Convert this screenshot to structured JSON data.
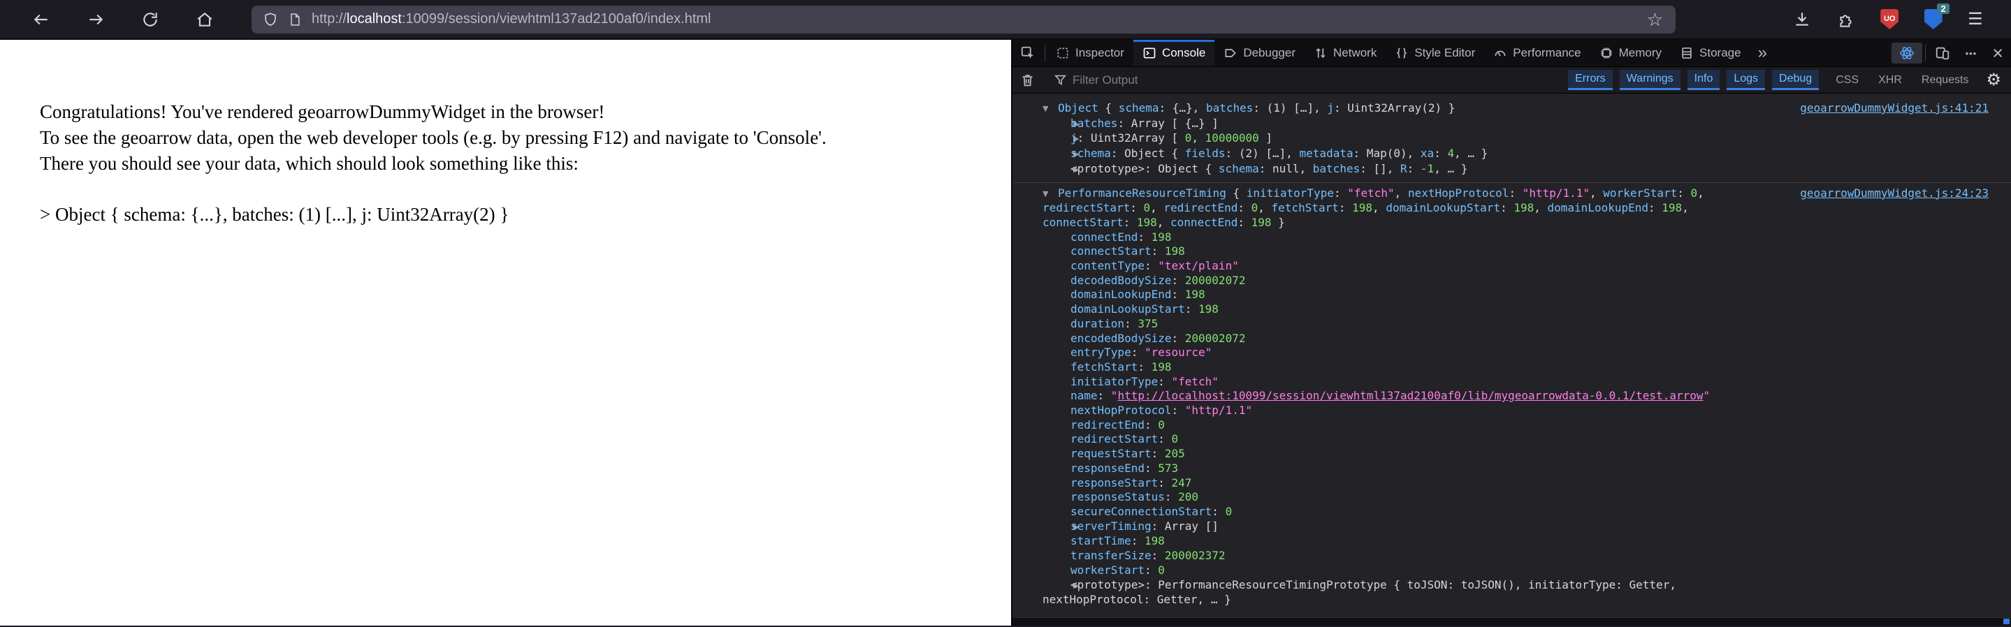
{
  "colors": {
    "accent_blue": "#2b6fd9",
    "property_name_blue": "#75bfff",
    "number_green": "#86de74",
    "string_pink": "#ff7de9",
    "console_bg": "#232327",
    "toolbar_bg": "#1c1b22",
    "urlbar_bg": "#42414d",
    "page_bg": "#ffffff"
  },
  "browser": {
    "url": {
      "prefix": "http://",
      "host": "localhost",
      "rest": ":10099/session/viewhtml137ad2100af0/index.html"
    },
    "extension_badge": "2",
    "icons": {
      "star": "☆",
      "menu": "☰",
      "ublock_label": "UO"
    }
  },
  "page": {
    "lines": [
      "Congratulations! You've rendered geoarrowDummyWidget in the browser!",
      "To see the geoarrow data, open the web developer tools (e.g. by pressing F12) and navigate to 'Console'.",
      "There you should see your data, which should look something like this:"
    ],
    "object_preview": "> Object { schema: {...}, batches: (1) [...], j: Uint32Array(2) }"
  },
  "devtools": {
    "tabs": [
      {
        "label": "Inspector"
      },
      {
        "label": "Console",
        "active": true
      },
      {
        "label": "Debugger"
      },
      {
        "label": "Network"
      },
      {
        "label": "Style Editor"
      },
      {
        "label": "Performance"
      },
      {
        "label": "Memory"
      },
      {
        "label": "Storage"
      }
    ],
    "more_tabs_icon": "»",
    "dots_icon": "•••",
    "close_icon": "×",
    "gear_icon": "⚙",
    "filter": {
      "placeholder": "Filter Output",
      "levels": [
        "Errors",
        "Warnings",
        "Info",
        "Logs",
        "Debug"
      ],
      "categories": [
        "CSS",
        "XHR",
        "Requests"
      ]
    },
    "console": {
      "logs": [
        {
          "source_link": "geoarrowDummyWidget.js:41:21",
          "rows": [
            {
              "kind": "header",
              "segments": [
                [
                  "tw",
                  "▼"
                ],
                [
                  "cls",
                  "Object"
                ],
                [
                  "pl",
                  " { "
                ],
                [
                  "nm",
                  "schema"
                ],
                [
                  "pl",
                  ": {…}, "
                ],
                [
                  "nm",
                  "batches"
                ],
                [
                  "pl",
                  ": (1) […], "
                ],
                [
                  "nm",
                  "j"
                ],
                [
                  "pl",
                  ": Uint32Array(2) }"
                ]
              ]
            },
            {
              "kind": "child",
              "segments": [
                [
                  "tw",
                  "▶"
                ],
                [
                  "nm",
                  "batches"
                ],
                [
                  "pl",
                  ": Array [ {…} ]"
                ]
              ]
            },
            {
              "kind": "child",
              "segments": [
                [
                  "tw",
                  "▶"
                ],
                [
                  "nm",
                  "j"
                ],
                [
                  "pl",
                  ": Uint32Array [ "
                ],
                [
                  "num",
                  "0"
                ],
                [
                  "pl",
                  ", "
                ],
                [
                  "num",
                  "10000000"
                ],
                [
                  "pl",
                  " ]"
                ]
              ]
            },
            {
              "kind": "child",
              "segments": [
                [
                  "tw",
                  "▶"
                ],
                [
                  "nm",
                  "schema"
                ],
                [
                  "pl",
                  ": Object { "
                ],
                [
                  "nm",
                  "fields"
                ],
                [
                  "pl",
                  ": (2) […], "
                ],
                [
                  "nm",
                  "metadata"
                ],
                [
                  "pl",
                  ": Map(0), "
                ],
                [
                  "nm",
                  "xa"
                ],
                [
                  "pl",
                  ": "
                ],
                [
                  "num",
                  "4"
                ],
                [
                  "pl",
                  ", … }"
                ]
              ]
            },
            {
              "kind": "child",
              "segments": [
                [
                  "tw",
                  "▶"
                ],
                [
                  "pl",
                  "<prototype>: Object { "
                ],
                [
                  "nm",
                  "schema"
                ],
                [
                  "pl",
                  ": null, "
                ],
                [
                  "nm",
                  "batches"
                ],
                [
                  "pl",
                  ": [], "
                ],
                [
                  "nm",
                  "R"
                ],
                [
                  "pl",
                  ": "
                ],
                [
                  "num",
                  "-1"
                ],
                [
                  "pl",
                  ", … }"
                ]
              ]
            }
          ]
        },
        {
          "source_link": "geoarrowDummyWidget.js:24:23",
          "rows": [
            {
              "kind": "header",
              "segments": [
                [
                  "tw",
                  "▼"
                ],
                [
                  "cls",
                  "PerformanceResourceTiming"
                ],
                [
                  "pl",
                  " { "
                ],
                [
                  "nm",
                  "initiatorType"
                ],
                [
                  "pl",
                  ": "
                ],
                [
                  "str",
                  "\"fetch\""
                ],
                [
                  "pl",
                  ", "
                ],
                [
                  "nm",
                  "nextHopProtocol"
                ],
                [
                  "pl",
                  ": "
                ],
                [
                  "str",
                  "\"http/1.1\""
                ],
                [
                  "pl",
                  ", "
                ],
                [
                  "nm",
                  "workerStart"
                ],
                [
                  "pl",
                  ": "
                ],
                [
                  "num",
                  "0"
                ],
                [
                  "pl",
                  ", "
                ],
                [
                  "nm",
                  "redirectStart"
                ],
                [
                  "pl",
                  ": "
                ],
                [
                  "num",
                  "0"
                ],
                [
                  "pl",
                  ", "
                ],
                [
                  "nm",
                  "redirectEnd"
                ],
                [
                  "pl",
                  ": "
                ],
                [
                  "num",
                  "0"
                ],
                [
                  "pl",
                  ", "
                ],
                [
                  "nm",
                  "fetchStart"
                ],
                [
                  "pl",
                  ": "
                ],
                [
                  "num",
                  "198"
                ],
                [
                  "pl",
                  ", "
                ],
                [
                  "nm",
                  "domainLookupStart"
                ],
                [
                  "pl",
                  ": "
                ],
                [
                  "num",
                  "198"
                ],
                [
                  "pl",
                  ", "
                ],
                [
                  "nm",
                  "domainLookupEnd"
                ],
                [
                  "pl",
                  ": "
                ],
                [
                  "num",
                  "198"
                ],
                [
                  "pl",
                  ", "
                ],
                [
                  "nm",
                  "connectStart"
                ],
                [
                  "pl",
                  ": "
                ],
                [
                  "num",
                  "198"
                ],
                [
                  "pl",
                  ", "
                ],
                [
                  "nm",
                  "connectEnd"
                ],
                [
                  "pl",
                  ": "
                ],
                [
                  "num",
                  "198"
                ],
                [
                  "pl",
                  " }"
                ]
              ]
            },
            {
              "kind": "child",
              "segments": [
                [
                  "nm",
                  "connectEnd"
                ],
                [
                  "pl",
                  ": "
                ],
                [
                  "num",
                  "198"
                ]
              ]
            },
            {
              "kind": "child",
              "segments": [
                [
                  "nm",
                  "connectStart"
                ],
                [
                  "pl",
                  ": "
                ],
                [
                  "num",
                  "198"
                ]
              ]
            },
            {
              "kind": "child",
              "segments": [
                [
                  "nm",
                  "contentType"
                ],
                [
                  "pl",
                  ": "
                ],
                [
                  "str",
                  "\"text/plain\""
                ]
              ]
            },
            {
              "kind": "child",
              "segments": [
                [
                  "nm",
                  "decodedBodySize"
                ],
                [
                  "pl",
                  ": "
                ],
                [
                  "num",
                  "200002072"
                ]
              ]
            },
            {
              "kind": "child",
              "segments": [
                [
                  "nm",
                  "domainLookupEnd"
                ],
                [
                  "pl",
                  ": "
                ],
                [
                  "num",
                  "198"
                ]
              ]
            },
            {
              "kind": "child",
              "segments": [
                [
                  "nm",
                  "domainLookupStart"
                ],
                [
                  "pl",
                  ": "
                ],
                [
                  "num",
                  "198"
                ]
              ]
            },
            {
              "kind": "child",
              "segments": [
                [
                  "nm",
                  "duration"
                ],
                [
                  "pl",
                  ": "
                ],
                [
                  "num",
                  "375"
                ]
              ]
            },
            {
              "kind": "child",
              "segments": [
                [
                  "nm",
                  "encodedBodySize"
                ],
                [
                  "pl",
                  ": "
                ],
                [
                  "num",
                  "200002072"
                ]
              ]
            },
            {
              "kind": "child",
              "segments": [
                [
                  "nm",
                  "entryType"
                ],
                [
                  "pl",
                  ": "
                ],
                [
                  "str",
                  "\"resource\""
                ]
              ]
            },
            {
              "kind": "child",
              "segments": [
                [
                  "nm",
                  "fetchStart"
                ],
                [
                  "pl",
                  ": "
                ],
                [
                  "num",
                  "198"
                ]
              ]
            },
            {
              "kind": "child",
              "segments": [
                [
                  "nm",
                  "initiatorType"
                ],
                [
                  "pl",
                  ": "
                ],
                [
                  "str",
                  "\"fetch\""
                ]
              ]
            },
            {
              "kind": "child",
              "segments": [
                [
                  "nm",
                  "name"
                ],
                [
                  "pl",
                  ": "
                ],
                [
                  "str",
                  "\""
                ],
                [
                  "url",
                  "http://localhost:10099/session/viewhtml137ad2100af0/lib/mygeoarrowdata-0.0.1/test.arrow"
                ],
                [
                  "str",
                  "\""
                ]
              ]
            },
            {
              "kind": "child",
              "segments": [
                [
                  "nm",
                  "nextHopProtocol"
                ],
                [
                  "pl",
                  ": "
                ],
                [
                  "str",
                  "\"http/1.1\""
                ]
              ]
            },
            {
              "kind": "child",
              "segments": [
                [
                  "nm",
                  "redirectEnd"
                ],
                [
                  "pl",
                  ": "
                ],
                [
                  "num",
                  "0"
                ]
              ]
            },
            {
              "kind": "child",
              "segments": [
                [
                  "nm",
                  "redirectStart"
                ],
                [
                  "pl",
                  ": "
                ],
                [
                  "num",
                  "0"
                ]
              ]
            },
            {
              "kind": "child",
              "segments": [
                [
                  "nm",
                  "requestStart"
                ],
                [
                  "pl",
                  ": "
                ],
                [
                  "num",
                  "205"
                ]
              ]
            },
            {
              "kind": "child",
              "segments": [
                [
                  "nm",
                  "responseEnd"
                ],
                [
                  "pl",
                  ": "
                ],
                [
                  "num",
                  "573"
                ]
              ]
            },
            {
              "kind": "child",
              "segments": [
                [
                  "nm",
                  "responseStart"
                ],
                [
                  "pl",
                  ": "
                ],
                [
                  "num",
                  "247"
                ]
              ]
            },
            {
              "kind": "child",
              "segments": [
                [
                  "nm",
                  "responseStatus"
                ],
                [
                  "pl",
                  ": "
                ],
                [
                  "num",
                  "200"
                ]
              ]
            },
            {
              "kind": "child",
              "segments": [
                [
                  "nm",
                  "secureConnectionStart"
                ],
                [
                  "pl",
                  ": "
                ],
                [
                  "num",
                  "0"
                ]
              ]
            },
            {
              "kind": "child",
              "segments": [
                [
                  "tw",
                  "▶"
                ],
                [
                  "nm",
                  "serverTiming"
                ],
                [
                  "pl",
                  ": Array []"
                ]
              ]
            },
            {
              "kind": "child",
              "segments": [
                [
                  "nm",
                  "startTime"
                ],
                [
                  "pl",
                  ": "
                ],
                [
                  "num",
                  "198"
                ]
              ]
            },
            {
              "kind": "child",
              "segments": [
                [
                  "nm",
                  "transferSize"
                ],
                [
                  "pl",
                  ": "
                ],
                [
                  "num",
                  "200002372"
                ]
              ]
            },
            {
              "kind": "child",
              "segments": [
                [
                  "nm",
                  "workerStart"
                ],
                [
                  "pl",
                  ": "
                ],
                [
                  "num",
                  "0"
                ]
              ]
            },
            {
              "kind": "child",
              "segments": [
                [
                  "tw",
                  "▶"
                ],
                [
                  "pl",
                  "<prototype>: PerformanceResourceTimingPrototype { toJSON: toJSON(), initiatorType: Getter, nextHopProtocol: Getter, … }"
                ]
              ]
            }
          ]
        }
      ]
    }
  }
}
